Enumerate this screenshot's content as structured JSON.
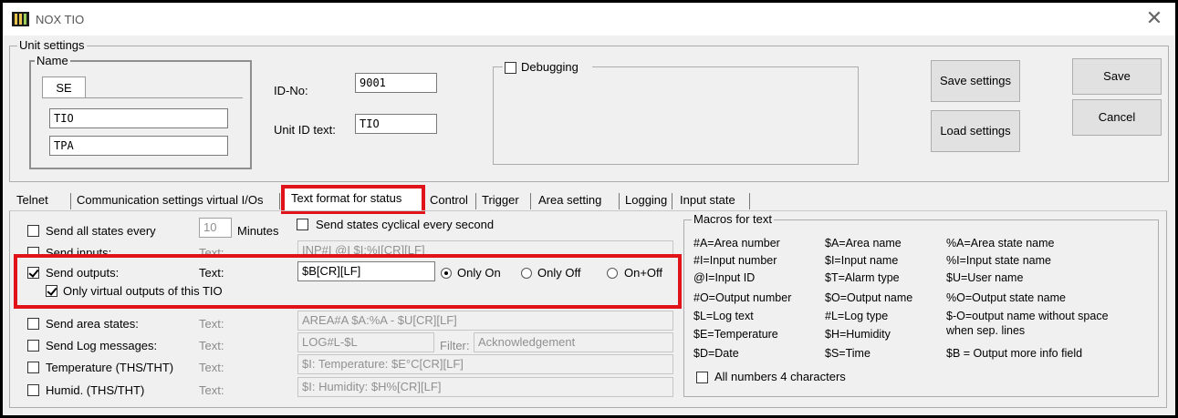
{
  "window": {
    "title": "NOX TIO"
  },
  "unit_settings": {
    "group_title": "Unit settings",
    "name_group_title": "Name",
    "name_tab": "SE",
    "name_values": [
      "TIO",
      "TPA"
    ],
    "id_label": "ID-No:",
    "id_value": "9001",
    "unit_id_label": "Unit ID text:",
    "unit_id_value": "TIO",
    "debugging_label": "Debugging",
    "save_settings": "Save settings",
    "load_settings": "Load settings",
    "save": "Save",
    "cancel": "Cancel"
  },
  "tabs": [
    {
      "label": "Telnet"
    },
    {
      "label": "Communication settings virtual I/Os"
    },
    {
      "label": "Text format for status"
    },
    {
      "label": "Control"
    },
    {
      "label": "Trigger"
    },
    {
      "label": "Area setting"
    },
    {
      "label": "Logging"
    },
    {
      "label": "Input state"
    }
  ],
  "status": {
    "send_all": {
      "label": "Send all states every",
      "value": "10",
      "unit": "Minutes",
      "checked": false
    },
    "cyclical": {
      "label": "Send states cyclical every second",
      "checked": false
    },
    "send_inputs": {
      "label": "Send inputs:",
      "text_label": "Text:",
      "value": "INP#I @I $I:%I[CR][LF]",
      "checked": false
    },
    "send_outputs": {
      "label": "Send outputs:",
      "text_label": "Text:",
      "value": "$B[CR][LF]",
      "checked": true,
      "radios": [
        {
          "label": "Only On",
          "selected": true
        },
        {
          "label": "Only Off",
          "selected": false
        },
        {
          "label": "On+Off",
          "selected": false
        }
      ],
      "virtual_only": {
        "label": "Only virtual outputs of this TIO",
        "checked": true
      }
    },
    "send_area": {
      "label": "Send area states:",
      "text_label": "Text:",
      "value": "AREA#A $A:%A - $U[CR][LF]",
      "checked": false
    },
    "send_log": {
      "label": "Send Log messages:",
      "text_label": "Text:",
      "value": "LOG#L-$L",
      "filter_label": "Filter:",
      "filter_value": "Acknowledgement",
      "checked": false
    },
    "temperature": {
      "label": "Temperature (THS/THT)",
      "text_label": "Text:",
      "value": "$I: Temperature: $E°C[CR][LF]",
      "checked": false
    },
    "humid": {
      "label": "Humid. (THS/THT)",
      "text_label": "Text:",
      "value": "$I: Humidity: $H%[CR][LF]",
      "checked": false
    }
  },
  "macros": {
    "title": "Macros for text",
    "col1": [
      "#A=Area number",
      "#I=Input number",
      "@I=Input ID",
      "#O=Output number",
      "$L=Log text",
      "$E=Temperature",
      "$D=Date"
    ],
    "col2": [
      "$A=Area name",
      "$I=Input name",
      "$T=Alarm type",
      "$O=Output name",
      "#L=Log type",
      "$H=Humidity",
      "$S=Time"
    ],
    "col3": [
      "%A=Area state name",
      "%I=Input state name",
      "$U=User name",
      "%O=Output state name",
      "$-O=output name without space",
      "when sep. lines",
      "$B = Output more info field"
    ],
    "all_numbers": {
      "label": "All numbers 4 characters",
      "checked": false
    }
  },
  "colors": {
    "highlight": "#e0131b",
    "window_bg": "#f0f0f0"
  }
}
